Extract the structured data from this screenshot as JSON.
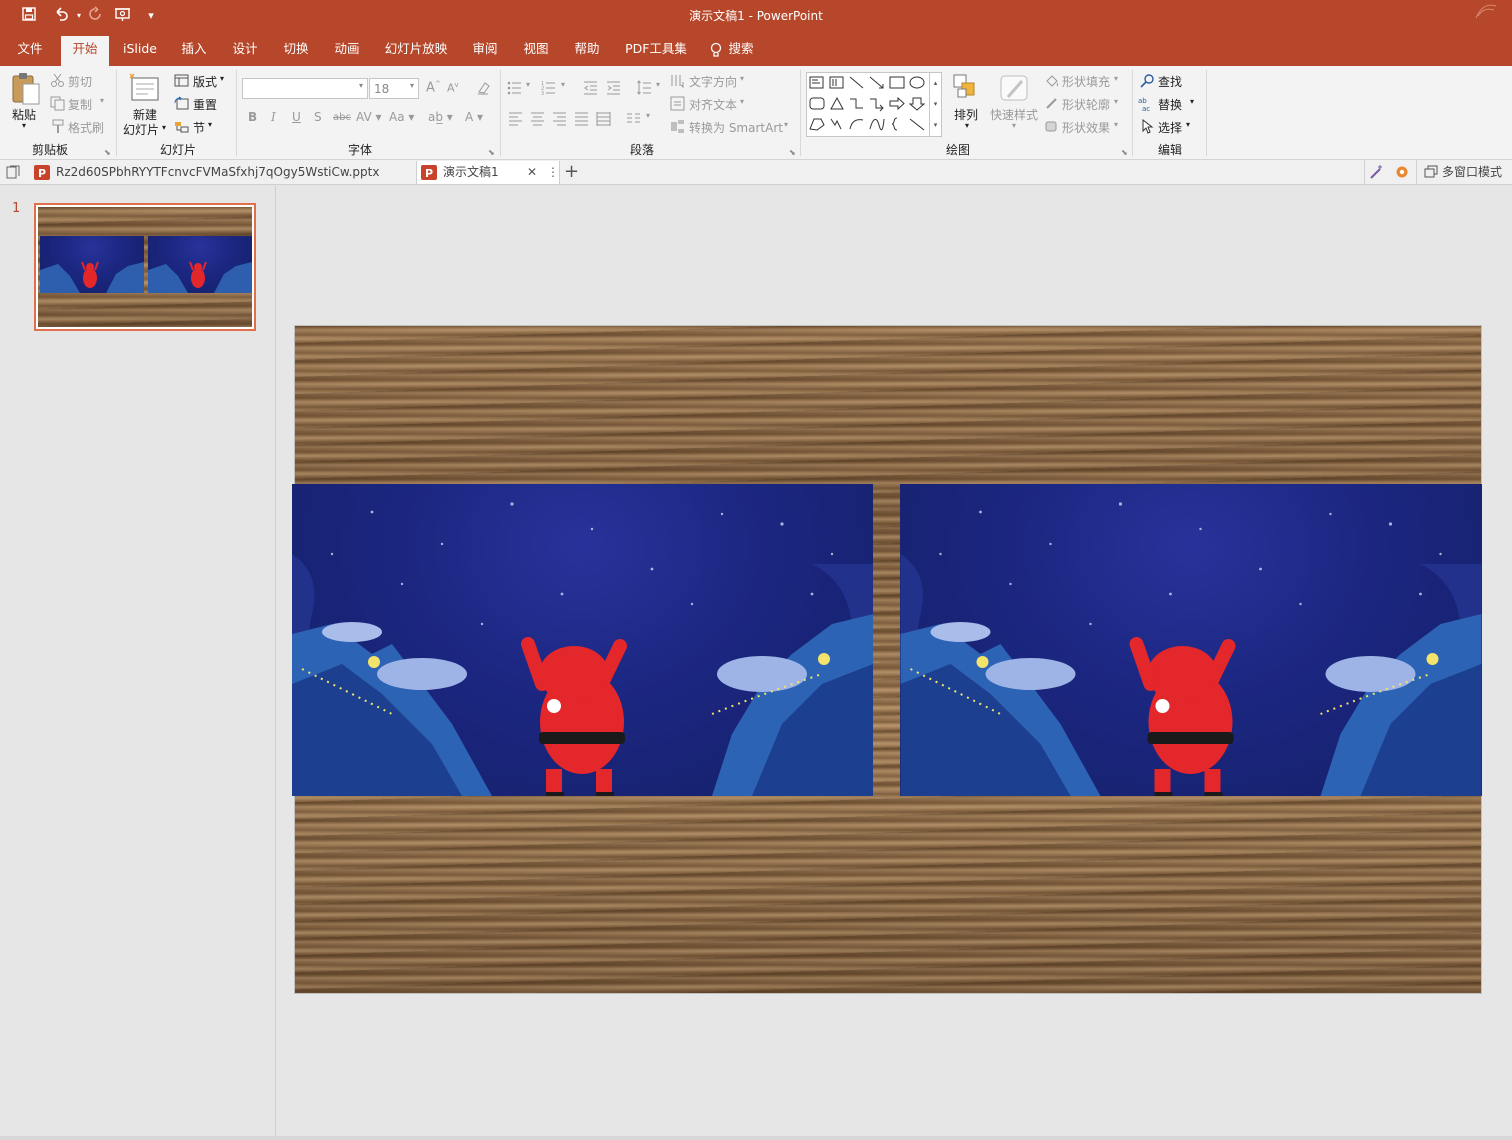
{
  "window": {
    "title": "演示文稿1  -  PowerPoint"
  },
  "quick_access": {
    "icons": [
      "save-icon",
      "undo-icon",
      "redo-icon",
      "present-icon",
      "customize-icon"
    ]
  },
  "menu_tabs": [
    "文件",
    "开始",
    "iSlide",
    "插入",
    "设计",
    "切换",
    "动画",
    "幻灯片放映",
    "审阅",
    "视图",
    "帮助",
    "PDF工具集",
    "搜索"
  ],
  "ribbon": {
    "clipboard": {
      "label": "剪贴板",
      "paste": "粘贴",
      "cut": "剪切",
      "copy": "复制",
      "format_painter": "格式刷"
    },
    "slides": {
      "label": "幻灯片",
      "new_slide": "新建",
      "new_slide2": "幻灯片",
      "layout": "版式",
      "reset": "重置",
      "section": "节"
    },
    "font": {
      "label": "字体",
      "font_name": "",
      "font_size": "18"
    },
    "paragraph": {
      "label": "段落",
      "text_direction": "文字方向",
      "align_text": "对齐文本",
      "smartart": "转换为 SmartArt"
    },
    "drawing": {
      "label": "绘图",
      "arrange": "排列",
      "quick_styles": "快速样式",
      "shape_fill": "形状填充",
      "shape_outline": "形状轮廓",
      "shape_effects": "形状效果"
    },
    "editing": {
      "label": "编辑",
      "find": "查找",
      "replace": "替换",
      "select": "选择"
    }
  },
  "doc_tabs": [
    {
      "name": "Rz2d60SPbhRYYTFcnvcFVMaSfxhj7qOgy5WstiCw.pptx"
    },
    {
      "name": "演示文稿1"
    }
  ],
  "doc_bar_right": {
    "multi_window": "多窗口模式"
  },
  "slide_panel": {
    "slide_number": "1"
  },
  "colors": {
    "accent": "#b7472a",
    "ribbon_bg": "#f3f3f3",
    "canvas_bg": "#e6e6e6",
    "selection_border": "#e0704b"
  }
}
